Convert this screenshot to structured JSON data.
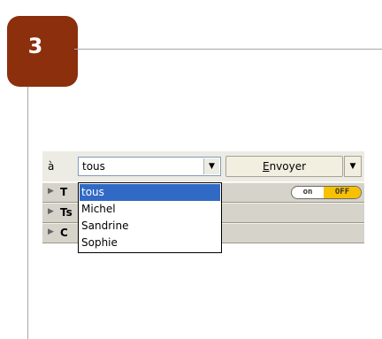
{
  "step": {
    "number": "3"
  },
  "toolbar": {
    "to_label": "à",
    "recipient_value": "tous",
    "send_label_first": "E",
    "send_label_rest": "nvoyer"
  },
  "panel_rows": [
    {
      "text": "T"
    },
    {
      "text": "Ts"
    },
    {
      "text": "C"
    }
  ],
  "toggle": {
    "on_label": "on",
    "off_label": "OFF",
    "state": "off"
  },
  "dropdown": {
    "options": [
      "tous",
      "Michel",
      "Sandrine",
      "Sophie"
    ],
    "selected": "tous"
  },
  "colors": {
    "badge": "#8b2f0d",
    "selection": "#316ac5",
    "toggle_off": "#f7c100"
  }
}
